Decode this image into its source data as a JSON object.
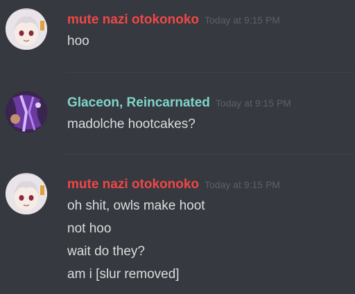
{
  "colors": {
    "background": "#36393f",
    "user_red": "#f04747",
    "user_teal": "#7fd6c9",
    "timestamp": "#5d6066",
    "text": "#dcddde"
  },
  "messages": [
    {
      "author": "mute nazi otokonoko",
      "timestamp": "Today at 9:15 PM",
      "avatar": "pale-haired-girl-avatar",
      "lines": [
        "hoo"
      ]
    },
    {
      "author": "Glaceon, Reincarnated",
      "timestamp": "Today at 9:15 PM",
      "avatar": "purple-dragon-avatar",
      "lines": [
        "madolche hootcakes?"
      ]
    },
    {
      "author": "mute nazi otokonoko",
      "timestamp": "Today at 9:15 PM",
      "avatar": "pale-haired-girl-avatar",
      "lines": [
        "oh shit, owls make hoot",
        "not hoo",
        "wait do they?",
        "am i [slur removed]"
      ]
    }
  ]
}
